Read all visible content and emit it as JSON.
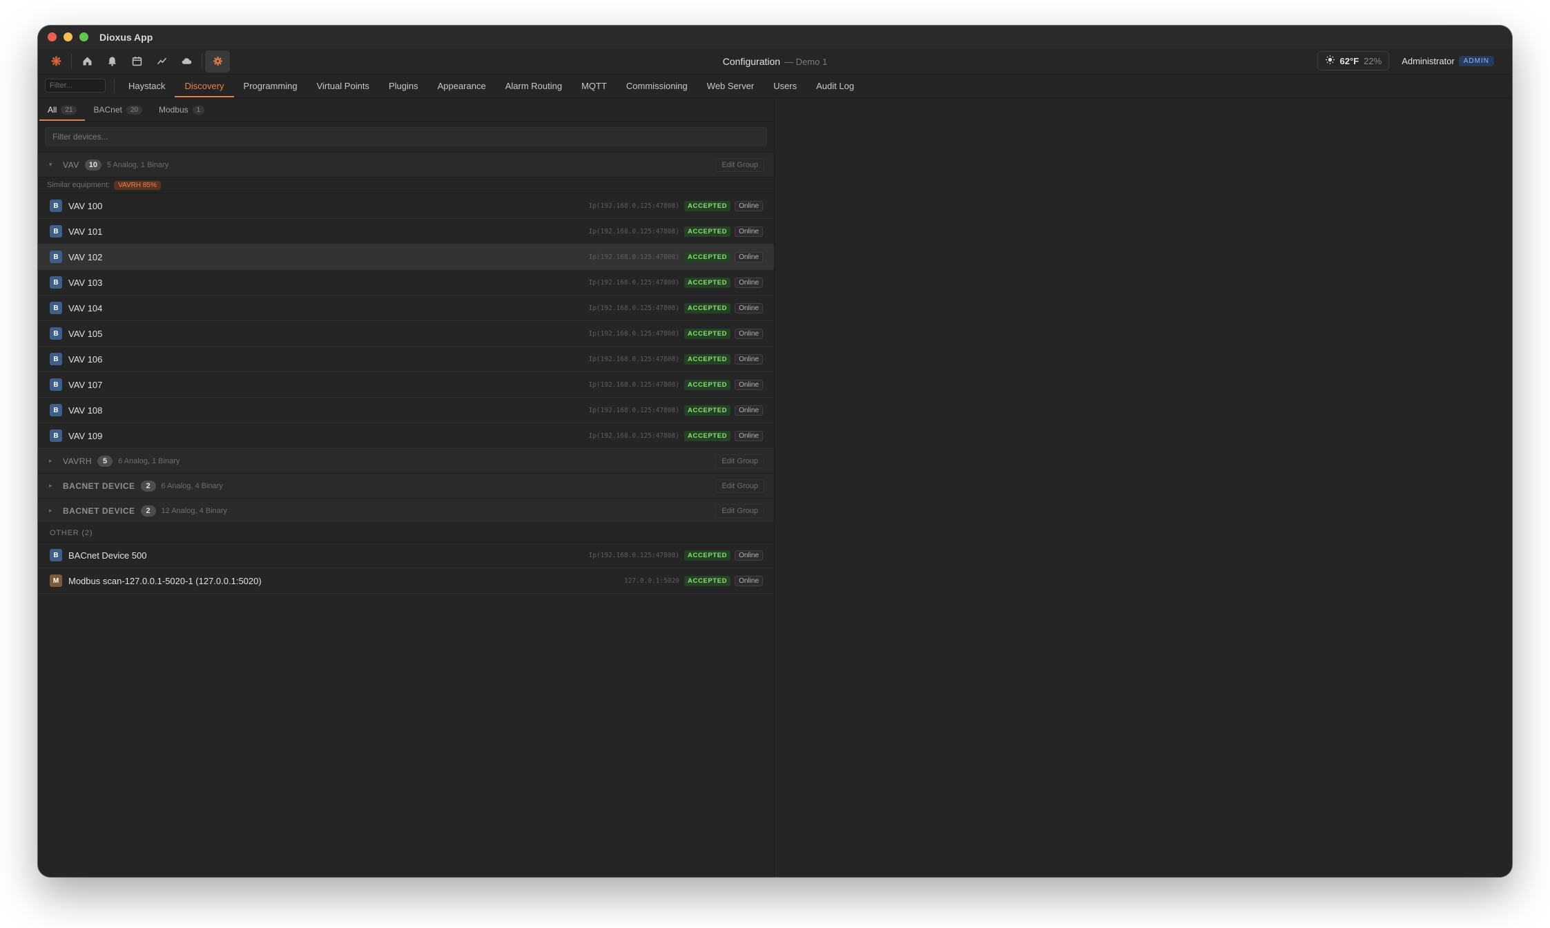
{
  "window": {
    "title": "Dioxus App"
  },
  "toolbar": {
    "center_title": "Configuration",
    "center_subtitle": "— Demo 1",
    "icons": [
      "logo-icon",
      "home-icon",
      "bell-icon",
      "calendar-icon",
      "trend-icon",
      "cloud-icon",
      "gear-icon"
    ],
    "weather": {
      "temp": "62°F",
      "humidity": "22%"
    },
    "user": {
      "name": "Administrator",
      "role": "ADMIN"
    }
  },
  "nav": {
    "filter_placeholder": "Filter...",
    "tabs": [
      "Haystack",
      "Discovery",
      "Programming",
      "Virtual Points",
      "Plugins",
      "Appearance",
      "Alarm Routing",
      "MQTT",
      "Commissioning",
      "Web Server",
      "Users",
      "Audit Log"
    ],
    "active": "Discovery"
  },
  "subtabs": [
    {
      "label": "All",
      "count": "21"
    },
    {
      "label": "BACnet",
      "count": "20"
    },
    {
      "label": "Modbus",
      "count": "1"
    }
  ],
  "filter": {
    "placeholder": "Filter devices..."
  },
  "groups": [
    {
      "name": "VAV",
      "count": "10",
      "desc": "5 Analog, 1 Binary",
      "edit_label": "Edit Group"
    },
    {
      "name": "VAVRH",
      "count": "5",
      "desc": "6 Analog, 1 Binary",
      "edit_label": "Edit Group"
    },
    {
      "name": "BACNET DEVICE",
      "count": "2",
      "desc": "6 Analog, 4 Binary",
      "edit_label": "Edit Group"
    },
    {
      "name": "BACNET DEVICE",
      "count": "2",
      "desc": "12 Analog, 4 Binary",
      "edit_label": "Edit Group"
    }
  ],
  "similar": {
    "label": "Similar equipment:",
    "tag": "VAVRH 85%"
  },
  "vav_devices": [
    {
      "type": "B",
      "name": "VAV 100",
      "addr": "Ip(192.168.0.125:47808)",
      "status": "ACCEPTED",
      "conn": "Online"
    },
    {
      "type": "B",
      "name": "VAV 101",
      "addr": "Ip(192.168.0.125:47808)",
      "status": "ACCEPTED",
      "conn": "Online"
    },
    {
      "type": "B",
      "name": "VAV 102",
      "addr": "Ip(192.168.0.125:47808)",
      "status": "ACCEPTED",
      "conn": "Online"
    },
    {
      "type": "B",
      "name": "VAV 103",
      "addr": "Ip(192.168.0.125:47808)",
      "status": "ACCEPTED",
      "conn": "Online"
    },
    {
      "type": "B",
      "name": "VAV 104",
      "addr": "Ip(192.168.0.125:47808)",
      "status": "ACCEPTED",
      "conn": "Online"
    },
    {
      "type": "B",
      "name": "VAV 105",
      "addr": "Ip(192.168.0.125:47808)",
      "status": "ACCEPTED",
      "conn": "Online"
    },
    {
      "type": "B",
      "name": "VAV 106",
      "addr": "Ip(192.168.0.125:47808)",
      "status": "ACCEPTED",
      "conn": "Online"
    },
    {
      "type": "B",
      "name": "VAV 107",
      "addr": "Ip(192.168.0.125:47808)",
      "status": "ACCEPTED",
      "conn": "Online"
    },
    {
      "type": "B",
      "name": "VAV 108",
      "addr": "Ip(192.168.0.125:47808)",
      "status": "ACCEPTED",
      "conn": "Online"
    },
    {
      "type": "B",
      "name": "VAV 109",
      "addr": "Ip(192.168.0.125:47808)",
      "status": "ACCEPTED",
      "conn": "Online"
    }
  ],
  "other": {
    "label": "OTHER (2)",
    "devices": [
      {
        "type": "B",
        "name": "BACnet Device 500",
        "addr": "Ip(192.168.0.125:47808)",
        "status": "ACCEPTED",
        "conn": "Online"
      },
      {
        "type": "M",
        "name": "Modbus scan-127.0.0.1-5020-1 (127.0.0.1:5020)",
        "addr": "127.0.0.1:5020",
        "status": "ACCEPTED",
        "conn": "Online"
      }
    ]
  }
}
